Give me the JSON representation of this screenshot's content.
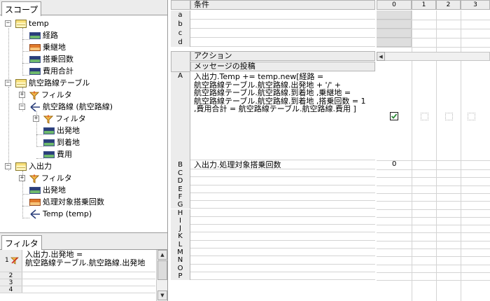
{
  "scope_panel": {
    "tab_label": "スコープ",
    "tree": [
      {
        "label": "temp",
        "icon": "table-icon",
        "level": 0,
        "expanded": true
      },
      {
        "label": "経路",
        "icon": "field-icon",
        "level": 1
      },
      {
        "label": "乗継地",
        "icon": "field-orange-icon",
        "level": 1
      },
      {
        "label": "搭乗回数",
        "icon": "field-icon",
        "level": 1
      },
      {
        "label": "費用合計",
        "icon": "field-icon",
        "level": 1
      },
      {
        "label": "航空路線テーブル",
        "icon": "table-icon",
        "level": 0,
        "expanded": true
      },
      {
        "label": "フィルタ",
        "icon": "filter-icon",
        "level": 1,
        "expanded": false
      },
      {
        "label": "航空路線 (航空路線)",
        "icon": "relation-icon",
        "level": 1,
        "expanded": true
      },
      {
        "label": "フィルタ",
        "icon": "filter-icon",
        "level": 2,
        "expanded": false
      },
      {
        "label": "出発地",
        "icon": "field-icon",
        "level": 2
      },
      {
        "label": "到着地",
        "icon": "field-icon",
        "level": 2
      },
      {
        "label": "費用",
        "icon": "field-icon",
        "level": 2
      },
      {
        "label": "入出力",
        "icon": "table-icon",
        "level": 0,
        "expanded": true
      },
      {
        "label": "フィルタ",
        "icon": "filter-icon",
        "level": 1,
        "expanded": false
      },
      {
        "label": "出発地",
        "icon": "field-icon",
        "level": 1
      },
      {
        "label": "処理対象搭乗回数",
        "icon": "field-orange-icon",
        "level": 1
      },
      {
        "label": "Temp (temp)",
        "icon": "relation-icon",
        "level": 1
      }
    ]
  },
  "filter_panel": {
    "tab_label": "フィルタ",
    "rows": [
      {
        "num": "1",
        "text": "入出力.出発地 =\n航空路線テーブル.航空路線.出発地"
      },
      {
        "num": "2",
        "text": ""
      },
      {
        "num": "3",
        "text": ""
      },
      {
        "num": "4",
        "text": ""
      }
    ]
  },
  "conditions": {
    "header": "条件",
    "rows": [
      "a",
      "b",
      "c",
      "d"
    ]
  },
  "actions": {
    "header": "アクション",
    "subheader": "メッセージの投稿",
    "rows": [
      {
        "label": "A",
        "text": "入出力.Temp += temp.new[経路 =\n航空路線テーブル.航空路線.出発地 + '/' +\n航空路線テーブル.航空路線.到着地 ,乗継地 =\n航空路線テーブル.航空路線.到着地 ,搭乗回数 = 1\n,費用合計 = 航空路線テーブル.航空路線.費用 ]"
      },
      {
        "label": "B",
        "text": "入出力.処理対象搭乗回数"
      },
      {
        "label": "C",
        "text": ""
      },
      {
        "label": "D",
        "text": ""
      },
      {
        "label": "E",
        "text": ""
      },
      {
        "label": "F",
        "text": ""
      },
      {
        "label": "G",
        "text": ""
      },
      {
        "label": "H",
        "text": ""
      },
      {
        "label": "I",
        "text": ""
      },
      {
        "label": "J",
        "text": ""
      },
      {
        "label": "K",
        "text": ""
      },
      {
        "label": "L",
        "text": ""
      },
      {
        "label": "M",
        "text": ""
      },
      {
        "label": "N",
        "text": ""
      },
      {
        "label": "O",
        "text": ""
      },
      {
        "label": "P",
        "text": ""
      }
    ]
  },
  "rules": {
    "columns": [
      "0",
      "1",
      "2",
      "3"
    ],
    "row_a_checked": true,
    "row_b_value": "0"
  },
  "colors": {
    "header_bg": "#ececec",
    "grid_line": "#d4d4d4",
    "disabled_cell": "#dedede",
    "check_mark": "#2e8b3a"
  }
}
